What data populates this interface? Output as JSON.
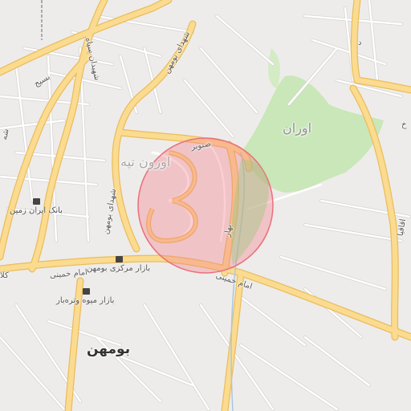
{
  "map": {
    "colors": {
      "background": "#eeecea",
      "major_road": "#fbdb8f",
      "major_road_casing": "#e9bd5e",
      "minor_road": "#ffffff",
      "minor_road_casing": "#d8d6d2",
      "park": "#c9e7b8",
      "highlight_fill": "rgba(244,128,140,0.38)",
      "highlight_stroke": "#ea6f7d",
      "railway": "#a9a9b5"
    },
    "labels": {
      "area_ozon_tappeh": "اوزون تپه",
      "park_ooran": "اوران",
      "city_boumehen": "بومهن",
      "road_shahid_boumehen": "شهدای بومهن",
      "road_sanobar": "صنوبر",
      "road_bahar": "بهار",
      "road_imam_khomeini": "امام خمینی",
      "road_imam_khomeini_left": "امام خمینی",
      "road_kala": "کلا",
      "road_shahidan_sepah": "شهیدان سپاه",
      "road_basij": "بسیج",
      "road_shahid_bahonar": "شهدای بومهن",
      "road_aghaghia": "اقاقیا",
      "road_sh": "شه",
      "road_dal": "د",
      "road_kh": "خ"
    },
    "pois": {
      "bank_iran_zamin": "بانک ایران زمین",
      "bazaar_markazi": "بازار مرکزی بومهن",
      "bazaar_miveh": "بازار میوه وتره‌بار"
    },
    "icons": {
      "bank": "bank-icon",
      "bazaar_markazi": "shopping-cart-icon",
      "bazaar_miveh": "shopping-cart-icon"
    }
  }
}
